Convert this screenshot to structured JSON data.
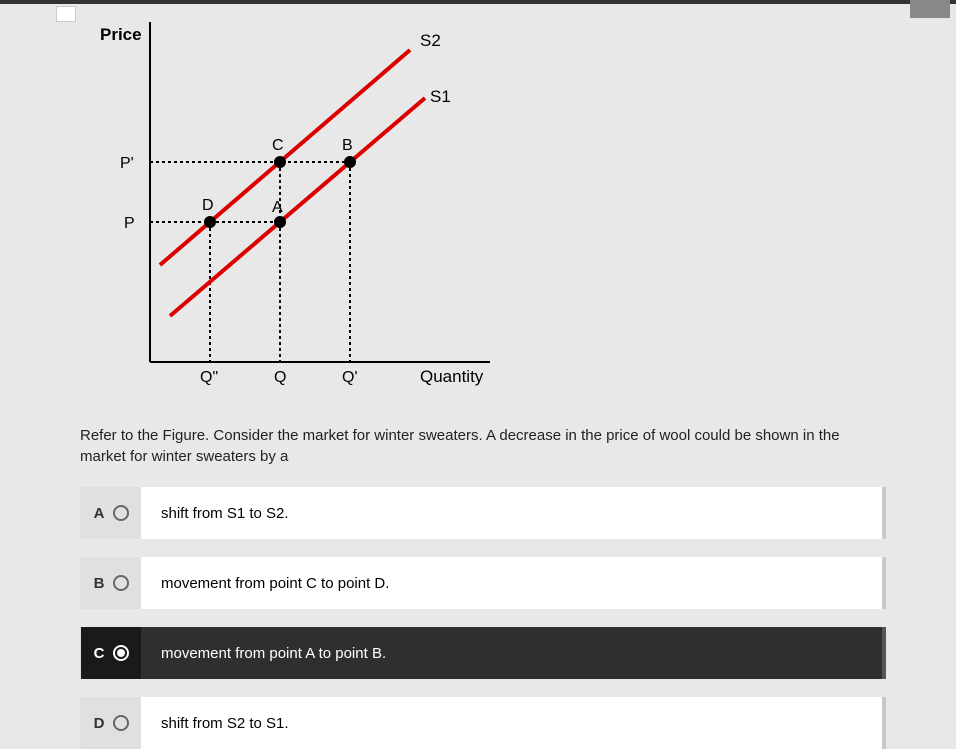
{
  "chart_data": {
    "type": "line",
    "title": "",
    "xlabel": "Quantity",
    "ylabel": "Price",
    "x_ticks": [
      "Q\"",
      "Q",
      "Q'"
    ],
    "y_ticks": [
      "P",
      "P'"
    ],
    "series": [
      {
        "name": "S1",
        "points": [
          [
            "Q\"",
            "P"
          ],
          [
            "Q",
            "P'"
          ]
        ],
        "label_pos": "top-right"
      },
      {
        "name": "S2",
        "points": [
          [
            "Q",
            "P"
          ],
          [
            "Q'",
            "P'"
          ]
        ],
        "label_pos": "top-right"
      }
    ],
    "points": [
      {
        "name": "A",
        "x": "Q",
        "y": "P",
        "curve": "S1"
      },
      {
        "name": "B",
        "x": "Q'",
        "y": "P'",
        "curve": "S1"
      },
      {
        "name": "C",
        "x": "Q",
        "y": "P'",
        "curve": "S2"
      },
      {
        "name": "D",
        "x": "Q\"",
        "y": "P",
        "curve": "S2"
      }
    ]
  },
  "axis_y_label": "Price",
  "axis_x_label": "Quantity",
  "y_tick_p_prime": "P'",
  "y_tick_p": "P",
  "x_tick_q2": "Q\"",
  "x_tick_q": "Q",
  "x_tick_qprime": "Q'",
  "curve_s1": "S1",
  "curve_s2": "S2",
  "pt_A": "A",
  "pt_B": "B",
  "pt_C": "C",
  "pt_D": "D",
  "question": "Refer to the Figure. Consider the market for winter sweaters. A decrease in the price of wool could be shown in the market for winter sweaters by a",
  "options": {
    "A": {
      "letter": "A",
      "text": "shift from S1 to S2.",
      "selected": false
    },
    "B": {
      "letter": "B",
      "text": "movement from point C to point D.",
      "selected": false
    },
    "C": {
      "letter": "C",
      "text": "movement from point A to point B.",
      "selected": true
    },
    "D": {
      "letter": "D",
      "text": "shift from S2 to S1.",
      "selected": false
    }
  }
}
